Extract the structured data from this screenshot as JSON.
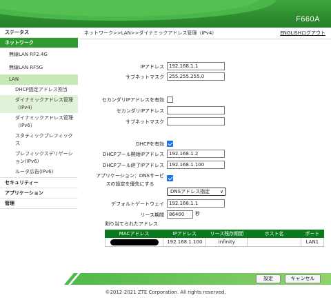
{
  "header": {
    "model": "F660A"
  },
  "sidebar": {
    "status": "ステータス",
    "network": "ネットワーク",
    "wlan24": "無線LAN RF2.4G",
    "wlan5": "無線LAN RF5G",
    "lan": "LAN",
    "lan_items": [
      "DHCP固定アドレス割当",
      "ダイナミックアドレス管理（IPv4）",
      "ダイナミックアドレス管理（IPv6）",
      "スタティックプレフィックス",
      "プレフィックスデリゲーション(IPv6)",
      "ルータ広告(IPv6)"
    ],
    "security": "セキュリティー",
    "application": "アプリケーション",
    "admin": "管理"
  },
  "breadcrumb": {
    "path": "ネットワーク>>LAN>>ダイナミックアドレス管理（IPv4）",
    "lang": "ENGLISH",
    "logout": "ログアウト"
  },
  "form": {
    "ip_label": "IPアドレス",
    "ip_value": "192.168.1.1",
    "mask_label": "サブネットマスク",
    "mask_value": "255.255.255.0",
    "secondary_enable_label": "セカンダリIPアドレスを有効",
    "secondary_enable_checked": false,
    "secondary_ip_label": "セカンダリIPアドレス",
    "secondary_ip_value": "",
    "secondary_mask_label": "サブネットマスク",
    "secondary_mask_value": "",
    "dhcp_enable_label": "DHCPを有効",
    "dhcp_enable_checked": true,
    "pool_start_label": "DHCPプール開始IPアドレス",
    "pool_start_value": "192.168.1.2",
    "pool_end_label": "DHCPプール終了IPアドレス",
    "pool_end_value": "192.168.1.100",
    "app_dns_label_1": "アプリケーション：DNSサービ",
    "app_dns_label_2": "スの設定を優先にする",
    "app_dns_checked": true,
    "dns_select_value": "DNSアドレス指定",
    "gateway_label": "デフォルトゲートウェイ",
    "gateway_value": "192.168.1.1",
    "lease_label": "リース期間",
    "lease_value": "86400",
    "lease_unit": "秒"
  },
  "lease_table": {
    "title": "割り当てられたアドレス",
    "columns": [
      "MACアドレス",
      "IPアドレス",
      "リース残存期間",
      "ホスト名",
      "ポート"
    ],
    "rows": [
      {
        "ip": "192.168.1.100",
        "remaining": "infinity",
        "host": "",
        "port": "LAN1"
      }
    ]
  },
  "buttons": {
    "apply": "設定",
    "cancel": "キャンセル"
  },
  "footer": {
    "copyright": "©2012-2021 ZTE Corporation. All rights reserved."
  }
}
